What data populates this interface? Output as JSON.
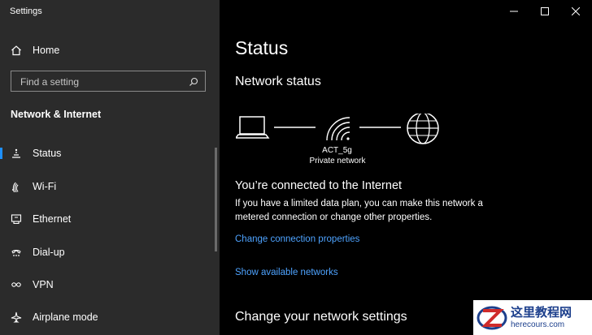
{
  "window": {
    "title": "Settings",
    "minimize_glyph": "—",
    "maximize_glyph": "☐",
    "close_glyph": "✕"
  },
  "sidebar": {
    "home_label": "Home",
    "search_placeholder": "Find a setting",
    "section_heading": "Network & Internet",
    "items": [
      {
        "label": "Status",
        "icon": "status-icon",
        "active": true
      },
      {
        "label": "Wi-Fi",
        "icon": "wifi-icon"
      },
      {
        "label": "Ethernet",
        "icon": "ethernet-icon"
      },
      {
        "label": "Dial-up",
        "icon": "dialup-icon"
      },
      {
        "label": "VPN",
        "icon": "vpn-icon"
      },
      {
        "label": "Airplane mode",
        "icon": "airplane-icon"
      }
    ]
  },
  "main": {
    "title": "Status",
    "network_status_heading": "Network status",
    "network": {
      "ssid": "ACT_5g",
      "type": "Private network"
    },
    "connected_heading": "You’re connected to the Internet",
    "connected_description": "If you have a limited data plan, you can make this network a metered connection or change other properties.",
    "change_connection_link": "Change connection properties",
    "show_networks_link": "Show available networks",
    "change_settings_heading": "Change your network settings"
  },
  "watermark": {
    "title": "这里教程网",
    "url": "herecours.com"
  },
  "colors": {
    "sidebar_bg": "#2b2b2b",
    "main_bg": "#000000",
    "accent": "#1e90ff",
    "link": "#4ea3ff"
  }
}
